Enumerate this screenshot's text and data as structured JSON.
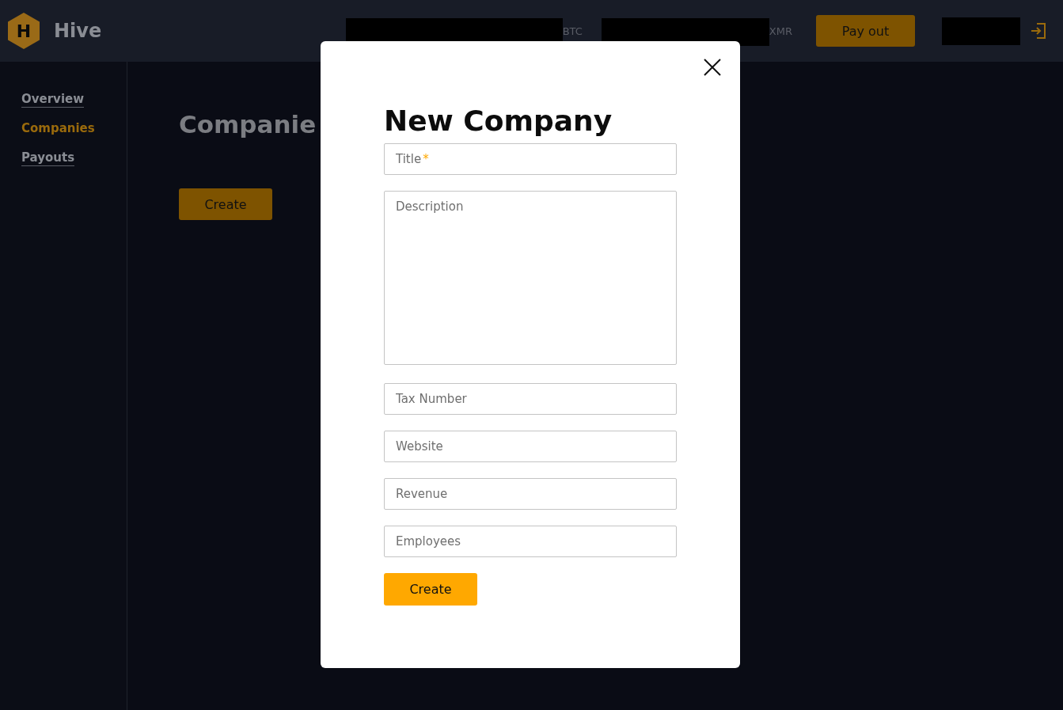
{
  "header": {
    "logo_letter": "H",
    "brand": "Hive",
    "balances": [
      {
        "currency": "BTC"
      },
      {
        "currency": "XMR"
      }
    ],
    "payout_button": "Pay out"
  },
  "sidebar": {
    "items": [
      {
        "label": "Overview",
        "selected": false
      },
      {
        "label": "Companies",
        "selected": true
      },
      {
        "label": "Payouts",
        "selected": false
      }
    ]
  },
  "main": {
    "heading": "Companie",
    "create_button": "Create"
  },
  "modal": {
    "title": "New Company",
    "fields": [
      {
        "kind": "text",
        "placeholder": "Title",
        "required_mark": "*"
      },
      {
        "kind": "textarea",
        "placeholder": "Description"
      },
      {
        "kind": "text",
        "placeholder": "Tax Number"
      },
      {
        "kind": "text",
        "placeholder": "Website"
      },
      {
        "kind": "text",
        "placeholder": "Revenue"
      },
      {
        "kind": "text",
        "placeholder": "Employees"
      }
    ],
    "submit_button": "Create"
  }
}
